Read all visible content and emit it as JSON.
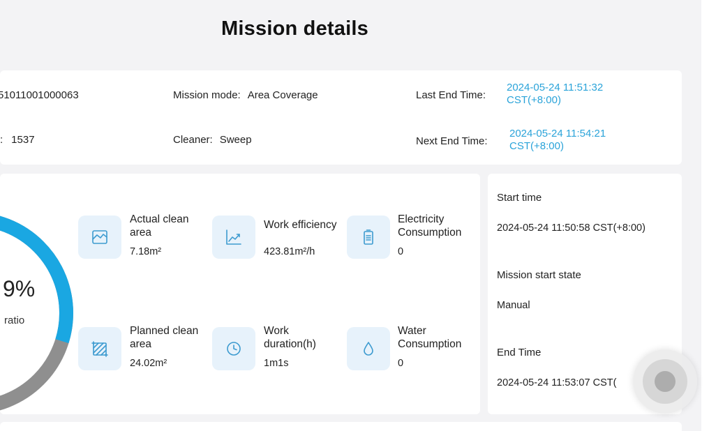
{
  "header": {
    "title": "Mission details"
  },
  "info": {
    "mission_id_value": "51011001000063",
    "mission_mode_label": "Mission mode:",
    "mission_mode_value": "Area Coverage",
    "last_end_time_label": "Last End Time:",
    "last_end_time_date": "2024-05-24 11:51:32",
    "last_end_time_tz": "CST(+8:00)",
    "left_field_separator": ":",
    "left_field_value": "1537",
    "cleaner_label": "Cleaner:",
    "cleaner_value": "Sweep",
    "next_end_time_label": "Next End Time:",
    "next_end_time_date": "2024-05-24 11:54:21",
    "next_end_time_tz": "CST(+8:00)"
  },
  "stats": {
    "percent_text": "9%",
    "ratio_label": "ratio",
    "ring_progress_fraction": 0.298,
    "ring_colors": {
      "progress": "#1aa7e2",
      "rest": "#8f8f8f"
    },
    "items": [
      {
        "label_line1": "Actual clean",
        "label_line2": "area",
        "value": "7.18m²",
        "icon": "area-map-icon"
      },
      {
        "label_line1": "Work efficiency",
        "label_line2": "",
        "value": "423.81m²/h",
        "icon": "trend-chart-icon"
      },
      {
        "label_line1": "Electricity",
        "label_line2": "Consumption",
        "value": "0",
        "icon": "battery-icon"
      },
      {
        "label_line1": "Planned clean",
        "label_line2": "area",
        "value": "24.02m²",
        "icon": "planned-area-icon"
      },
      {
        "label_line1": "Work",
        "label_line2": "duration(h)",
        "value": "1m1s",
        "icon": "clock-icon"
      },
      {
        "label_line1": "Water",
        "label_line2": "Consumption",
        "value": "0",
        "icon": "water-drop-icon"
      }
    ]
  },
  "side": {
    "start_time_label": "Start time",
    "start_time_value": "2024-05-24 11:50:58  CST(+8:00)",
    "start_state_label": "Mission start state",
    "start_state_value": "Manual",
    "end_time_label": "End Time",
    "end_time_value": "2024-05-24 11:53:07  CST("
  },
  "colors": {
    "accent": "#2aa3d9",
    "tile_bg": "#e7f2fb",
    "icon_stroke": "#3d9bd0",
    "page_bg": "#f3f3f5"
  }
}
